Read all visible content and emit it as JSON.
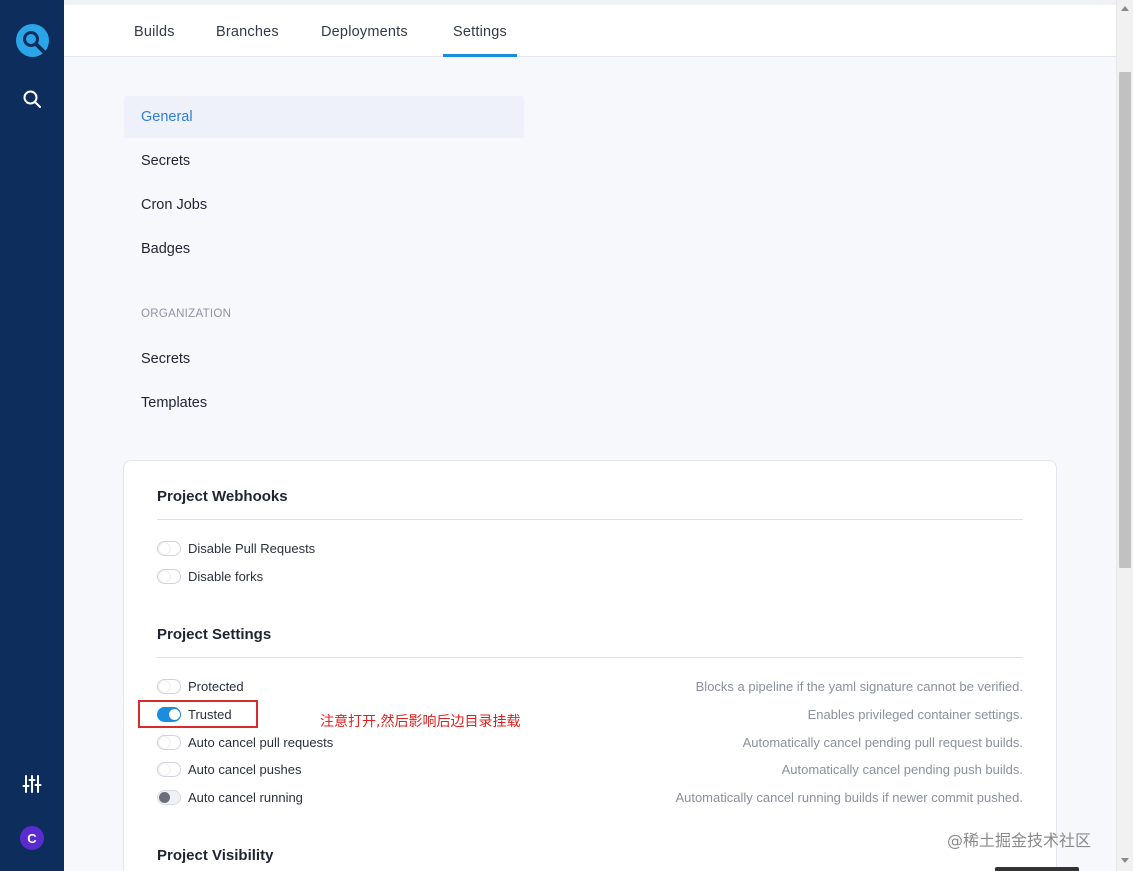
{
  "rail": {
    "logo_icon": "drone-logo-icon",
    "search_icon": "search-icon",
    "sliders_icon": "sliders-icon",
    "avatar_letter": "C",
    "avatar_color": "#5b2bd0"
  },
  "tabs": [
    {
      "label": "Builds"
    },
    {
      "label": "Branches"
    },
    {
      "label": "Deployments"
    },
    {
      "label": "Settings",
      "active": true
    }
  ],
  "settings_nav": {
    "items": [
      {
        "label": "General",
        "active": true
      },
      {
        "label": "Secrets"
      },
      {
        "label": "Cron Jobs"
      },
      {
        "label": "Badges"
      }
    ],
    "org_heading": "ORGANIZATION",
    "org_items": [
      {
        "label": "Secrets"
      },
      {
        "label": "Templates"
      }
    ]
  },
  "webhooks": {
    "title": "Project Webhooks",
    "options": [
      {
        "label": "Disable Pull Requests",
        "enabled": false
      },
      {
        "label": "Disable forks",
        "enabled": false
      }
    ]
  },
  "project_settings": {
    "title": "Project Settings",
    "options": [
      {
        "label": "Protected",
        "state": "off",
        "description": "Blocks a pipeline if the yaml signature cannot be verified."
      },
      {
        "label": "Trusted",
        "state": "on",
        "description": "Enables privileged container settings."
      },
      {
        "label": "Auto cancel pull requests",
        "state": "off",
        "description": "Automatically cancel pending pull request builds."
      },
      {
        "label": "Auto cancel pushes",
        "state": "off",
        "description": "Automatically cancel pending push builds."
      },
      {
        "label": "Auto cancel running",
        "state": "indeterminate",
        "description": "Automatically cancel running builds if newer commit pushed."
      }
    ]
  },
  "visibility": {
    "title": "Project Visibility"
  },
  "annotation": {
    "note": "注意打开,然后影响后边目录挂载",
    "color": "#e02020"
  },
  "watermark": "@稀土掘金技术社区",
  "colors": {
    "accent": "#1a8de0",
    "rail": "#0d2d5c"
  }
}
